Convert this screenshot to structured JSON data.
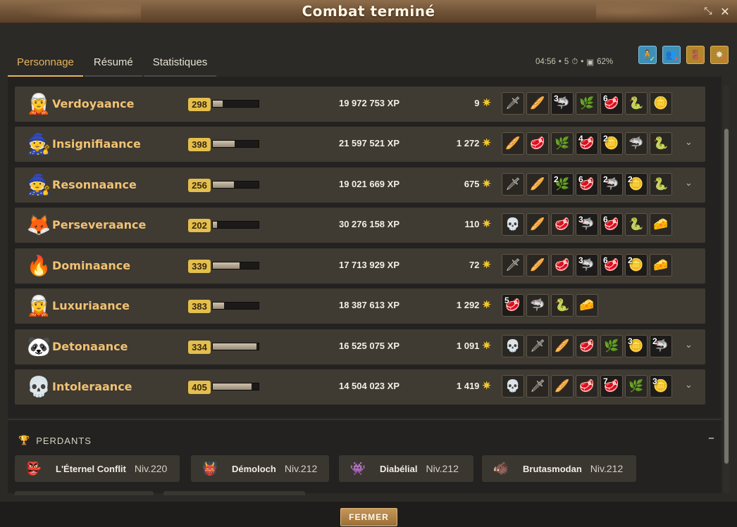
{
  "window": {
    "title": "Combat terminé"
  },
  "tabs": [
    {
      "label": "Personnage",
      "active": true
    },
    {
      "label": "Résumé",
      "active": false
    },
    {
      "label": "Statistiques",
      "active": false
    }
  ],
  "meta": {
    "duration": "04:56",
    "turns": "5",
    "drop_bonus": "62%"
  },
  "winners": [
    {
      "name": "Verdoyaance",
      "level": "298",
      "progress": 0.22,
      "xp": "19 972 753 XP",
      "kamas": "9",
      "loot": [
        {
          "icon": "🗡",
          "qty": ""
        },
        {
          "icon": "🥖",
          "qty": ""
        },
        {
          "icon": "🦈",
          "qty": "3"
        },
        {
          "icon": "🌿",
          "qty": ""
        },
        {
          "icon": "🥩",
          "qty": "6"
        },
        {
          "icon": "🐍",
          "qty": ""
        },
        {
          "icon": "🪙",
          "qty": ""
        }
      ],
      "expandable": false
    },
    {
      "name": "Insignifiaance",
      "level": "398",
      "progress": 0.47,
      "xp": "21 597 521 XP",
      "kamas": "1 272",
      "loot": [
        {
          "icon": "🥖",
          "qty": ""
        },
        {
          "icon": "🥩",
          "qty": ""
        },
        {
          "icon": "🌿",
          "qty": ""
        },
        {
          "icon": "🥩",
          "qty": "4"
        },
        {
          "icon": "🪙",
          "qty": "2"
        },
        {
          "icon": "🦈",
          "qty": ""
        },
        {
          "icon": "🐍",
          "qty": ""
        }
      ],
      "expandable": true
    },
    {
      "name": "Resonnaance",
      "level": "256",
      "progress": 0.46,
      "xp": "19 021 669 XP",
      "kamas": "675",
      "loot": [
        {
          "icon": "🗡",
          "qty": ""
        },
        {
          "icon": "🥖",
          "qty": ""
        },
        {
          "icon": "🌿",
          "qty": "2"
        },
        {
          "icon": "🥩",
          "qty": "6"
        },
        {
          "icon": "🦈",
          "qty": "2"
        },
        {
          "icon": "🪙",
          "qty": "2"
        },
        {
          "icon": "🐍",
          "qty": ""
        }
      ],
      "expandable": true
    },
    {
      "name": "Perseveraance",
      "level": "202",
      "progress": 0.09,
      "xp": "30 276 158 XP",
      "kamas": "110",
      "loot": [
        {
          "icon": "💀",
          "qty": ""
        },
        {
          "icon": "🥖",
          "qty": ""
        },
        {
          "icon": "🥩",
          "qty": ""
        },
        {
          "icon": "🦈",
          "qty": "3"
        },
        {
          "icon": "🥩",
          "qty": "6"
        },
        {
          "icon": "🐍",
          "qty": ""
        },
        {
          "icon": "🧀",
          "qty": ""
        }
      ],
      "expandable": false
    },
    {
      "name": "Dominaance",
      "level": "339",
      "progress": 0.58,
      "xp": "17 713 929 XP",
      "kamas": "72",
      "loot": [
        {
          "icon": "🗡",
          "qty": ""
        },
        {
          "icon": "🥖",
          "qty": ""
        },
        {
          "icon": "🥩",
          "qty": ""
        },
        {
          "icon": "🦈",
          "qty": "3"
        },
        {
          "icon": "🥩",
          "qty": "6"
        },
        {
          "icon": "🪙",
          "qty": "2"
        },
        {
          "icon": "🧀",
          "qty": ""
        }
      ],
      "expandable": false
    },
    {
      "name": "Luxuriaance",
      "level": "383",
      "progress": 0.24,
      "xp": "18 387 613 XP",
      "kamas": "1 292",
      "loot": [
        {
          "icon": "🥩",
          "qty": "5"
        },
        {
          "icon": "🦈",
          "qty": ""
        },
        {
          "icon": "🐍",
          "qty": ""
        },
        {
          "icon": "🧀",
          "qty": ""
        }
      ],
      "expandable": false
    },
    {
      "name": "Detonaance",
      "level": "334",
      "progress": 0.95,
      "xp": "16 525 075 XP",
      "kamas": "1 091",
      "loot": [
        {
          "icon": "💀",
          "qty": ""
        },
        {
          "icon": "🗡",
          "qty": ""
        },
        {
          "icon": "🥖",
          "qty": ""
        },
        {
          "icon": "🥩",
          "qty": ""
        },
        {
          "icon": "🌿",
          "qty": ""
        },
        {
          "icon": "🪙",
          "qty": "3"
        },
        {
          "icon": "🦈",
          "qty": "2"
        }
      ],
      "expandable": true
    },
    {
      "name": "Intoleraance",
      "level": "405",
      "progress": 0.84,
      "xp": "14 504 023 XP",
      "kamas": "1 419",
      "loot": [
        {
          "icon": "💀",
          "qty": ""
        },
        {
          "icon": "🗡",
          "qty": ""
        },
        {
          "icon": "🥖",
          "qty": ""
        },
        {
          "icon": "🥩",
          "qty": ""
        },
        {
          "icon": "🥩",
          "qty": "7"
        },
        {
          "icon": "🌿",
          "qty": ""
        },
        {
          "icon": "🪙",
          "qty": "3"
        }
      ],
      "expandable": true
    }
  ],
  "losers": {
    "title": "PERDANTS",
    "items": [
      {
        "name": "L'Éternel Conflit",
        "level": "Niv.220"
      },
      {
        "name": "Démoloch",
        "level": "Niv.212"
      },
      {
        "name": "Diabélial",
        "level": "Niv.212"
      },
      {
        "name": "Brutasmodan",
        "level": "Niv.212"
      }
    ]
  },
  "footer": {
    "close_label": "FERMER"
  },
  "colors": {
    "accent": "#e8b35b",
    "name": "#f1c273",
    "level_badge": "#e5bf4d",
    "kama": "#f0c62f"
  }
}
